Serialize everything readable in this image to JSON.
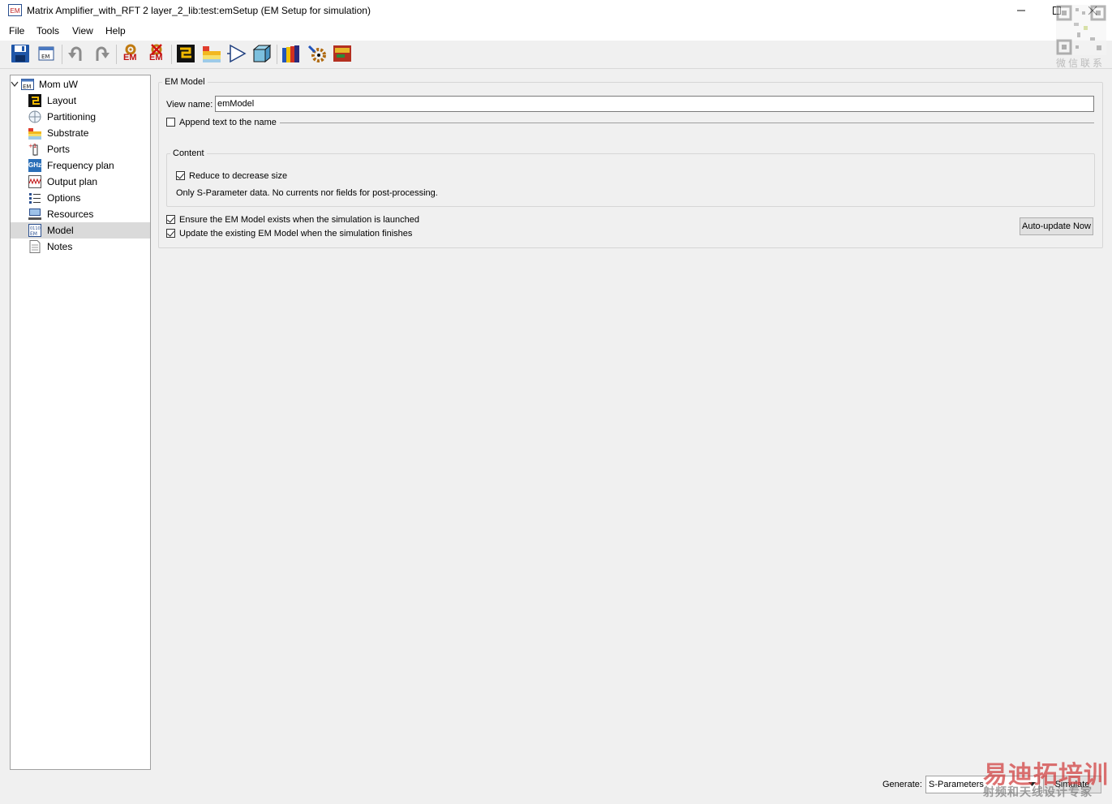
{
  "window": {
    "app_icon": "EM",
    "title": "Matrix Amplifier_with_RFT 2 layer_2_lib:test:emSetup (EM Setup for simulation)",
    "minimize_icon": "minimize-icon",
    "maximize_icon": "maximize-icon",
    "close_icon": "close-icon"
  },
  "menubar": {
    "items": [
      {
        "label": "File"
      },
      {
        "label": "Tools"
      },
      {
        "label": "View"
      },
      {
        "label": "Help"
      }
    ]
  },
  "toolbar": {
    "buttons": [
      {
        "icon": "save-icon"
      },
      {
        "icon": "em-window-icon"
      },
      {
        "icon": "undo-icon"
      },
      {
        "icon": "redo-icon"
      },
      {
        "icon": "em-simulate-icon",
        "text": "EM"
      },
      {
        "icon": "em-stop-icon",
        "text": "EM"
      },
      {
        "icon": "layout-icon"
      },
      {
        "icon": "substrate-icon"
      },
      {
        "icon": "amplifier-icon"
      },
      {
        "icon": "box-3d-icon"
      },
      {
        "icon": "material-stack-icon"
      },
      {
        "icon": "gear-tools-icon"
      },
      {
        "icon": "layer-view-icon"
      }
    ]
  },
  "tree": {
    "root": {
      "label": "Mom uW",
      "icon": "em-root-icon",
      "expanded": true
    },
    "items": [
      {
        "label": "Layout",
        "icon": "layout-icon"
      },
      {
        "label": "Partitioning",
        "icon": "partitioning-icon"
      },
      {
        "label": "Substrate",
        "icon": "substrate-icon"
      },
      {
        "label": "Ports",
        "icon": "ports-icon"
      },
      {
        "label": "Frequency plan",
        "icon": "frequency-plan-icon",
        "icon_text": "GHz"
      },
      {
        "label": "Output plan",
        "icon": "output-plan-icon"
      },
      {
        "label": "Options",
        "icon": "options-icon"
      },
      {
        "label": "Resources",
        "icon": "resources-icon"
      },
      {
        "label": "Model",
        "icon": "model-icon",
        "selected": true
      },
      {
        "label": "Notes",
        "icon": "notes-icon"
      }
    ]
  },
  "em_model": {
    "group_title": "EM Model",
    "view_name_label": "View name:",
    "view_name_value": "emModel",
    "append_text_label": "Append text to the name",
    "append_text_checked": false,
    "content": {
      "group_title": "Content",
      "reduce_label": "Reduce to decrease size",
      "reduce_checked": true,
      "note": "Only S-Parameter data. No currents nor fields for post-processing."
    },
    "ensure_label": "Ensure the EM Model exists when the simulation is launched",
    "ensure_checked": true,
    "update_label": "Update the existing EM Model when the simulation finishes",
    "update_checked": true,
    "auto_update_button": "Auto-update Now"
  },
  "footer": {
    "generate_label": "Generate:",
    "generate_value": "S-Parameters",
    "simulate_button": "Simulate"
  },
  "watermarks": {
    "qr_caption": "微信联系",
    "brand": "易迪拓培训",
    "brand_sub": "射频和天线设计专家"
  }
}
